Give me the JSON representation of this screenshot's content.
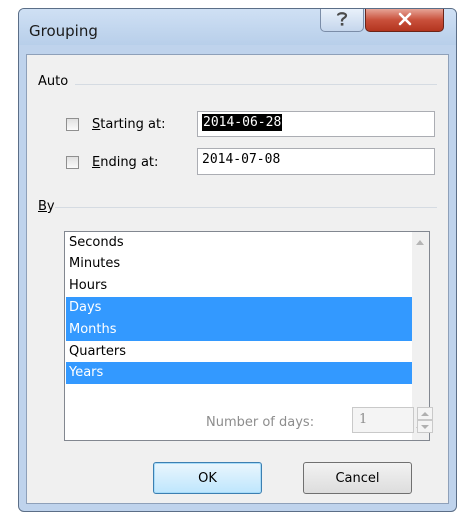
{
  "window": {
    "title": "Grouping"
  },
  "auto_group": {
    "label": "Auto",
    "starting_at": {
      "label_mnemonic": "S",
      "label_rest": "tarting at:",
      "checked": false,
      "value": "2014-06-28"
    },
    "ending_at": {
      "label_mnemonic": "E",
      "label_rest": "nding at:",
      "checked": false,
      "value": "2014-07-08"
    }
  },
  "by_group": {
    "label_mnemonic": "B",
    "label_rest": "y",
    "items": [
      {
        "label": "Seconds",
        "selected": false
      },
      {
        "label": "Minutes",
        "selected": false
      },
      {
        "label": "Hours",
        "selected": false
      },
      {
        "label": "Days",
        "selected": true
      },
      {
        "label": "Months",
        "selected": true
      },
      {
        "label": "Quarters",
        "selected": false
      },
      {
        "label": "Years",
        "selected": true
      }
    ]
  },
  "number_of_days": {
    "label": "Number of days:",
    "value": "1",
    "enabled": false
  },
  "buttons": {
    "ok": "OK",
    "cancel": "Cancel"
  },
  "colors": {
    "selection": "#3399ff",
    "close_button": "#c9503b"
  },
  "icons": {
    "help": "help-icon",
    "close": "close-icon"
  }
}
